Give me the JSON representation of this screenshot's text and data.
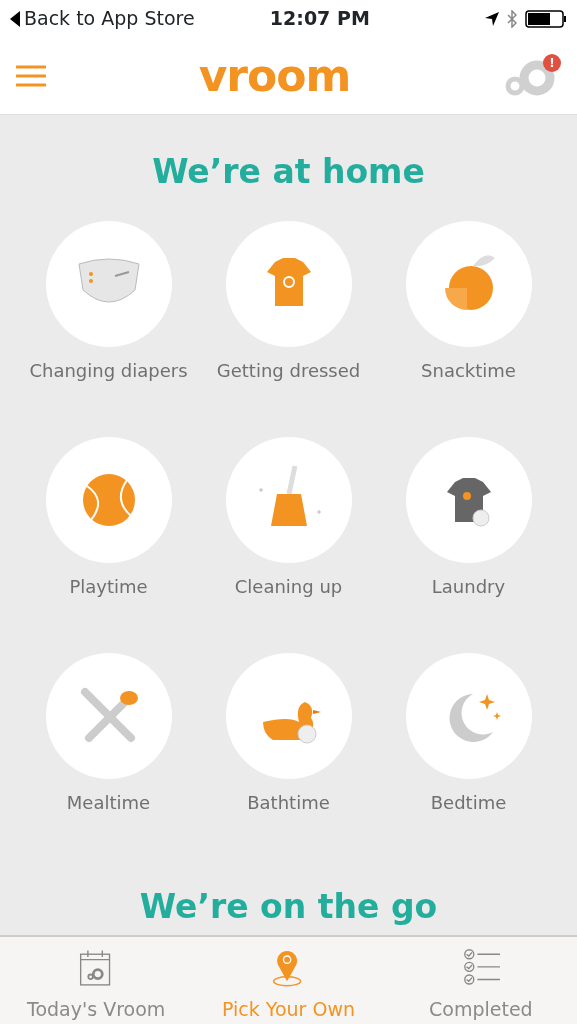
{
  "status_bar": {
    "back": "Back to App Store",
    "time": "12:07 PM"
  },
  "header": {
    "logo": "vroom",
    "alert_badge": "!"
  },
  "sections": [
    {
      "title": "We’re at home",
      "items": [
        {
          "label": "Changing diapers"
        },
        {
          "label": "Getting dressed"
        },
        {
          "label": "Snacktime"
        },
        {
          "label": "Playtime"
        },
        {
          "label": "Cleaning up"
        },
        {
          "label": "Laundry"
        },
        {
          "label": "Mealtime"
        },
        {
          "label": "Bathtime"
        },
        {
          "label": "Bedtime"
        }
      ]
    },
    {
      "title": "We’re on the go"
    }
  ],
  "tabs": [
    {
      "label": "Today's Vroom",
      "selected": false
    },
    {
      "label": "Pick Your Own",
      "selected": true
    },
    {
      "label": "Completed",
      "selected": false
    }
  ]
}
